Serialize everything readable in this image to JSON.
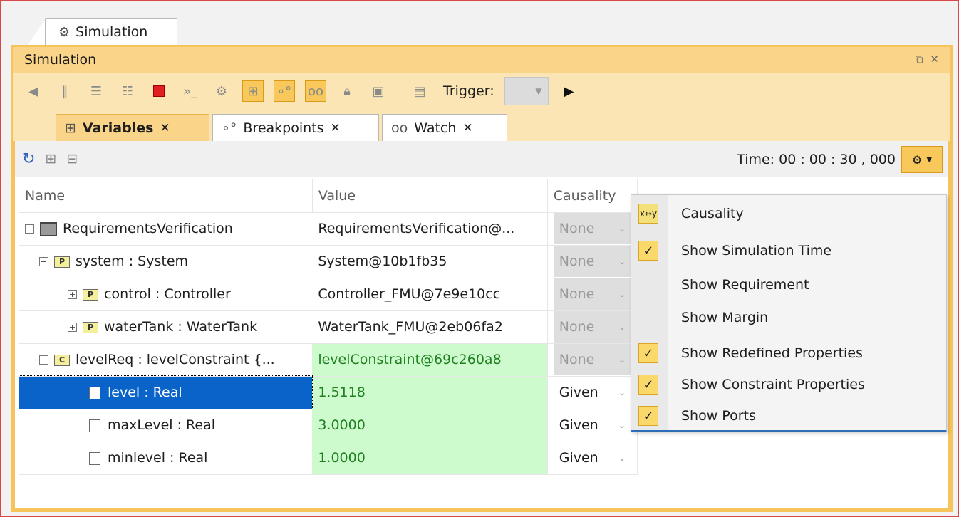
{
  "window": {
    "tab_label": "Simulation"
  },
  "panel": {
    "title": "Simulation",
    "trigger_label": "Trigger:"
  },
  "subtabs": [
    {
      "label": "Variables",
      "active": true
    },
    {
      "label": "Breakpoints",
      "active": false
    },
    {
      "label": "Watch",
      "active": false
    }
  ],
  "content": {
    "time_label": "Time: 00 : 00 : 30 , 000"
  },
  "table": {
    "headers": [
      "Name",
      "Value",
      "Causality"
    ],
    "rows": [
      {
        "name": "RequirementsVerification",
        "value": "RequirementsVerification@...",
        "causality": "None"
      },
      {
        "name": "system : System",
        "value": "System@10b1fb35",
        "causality": "None"
      },
      {
        "name": "control : Controller",
        "value": "Controller_FMU@7e9e10cc",
        "causality": "None"
      },
      {
        "name": "waterTank : WaterTank",
        "value": "WaterTank_FMU@2eb06fa2",
        "causality": "None"
      },
      {
        "name": "levelReq : levelConstraint {...",
        "value": "levelConstraint@69c260a8",
        "causality": "None"
      },
      {
        "name": "level : Real",
        "value": "1.5118",
        "causality": "Given"
      },
      {
        "name": "maxLevel : Real",
        "value": "3.0000",
        "causality": "Given"
      },
      {
        "name": "minlevel : Real",
        "value": "1.0000",
        "causality": "Given"
      }
    ]
  },
  "menu": {
    "items": [
      {
        "label": "Causality",
        "checked": false
      },
      {
        "label": "Show Simulation Time",
        "checked": true
      },
      {
        "label": "Show Requirement",
        "checked": false
      },
      {
        "label": "Show Margin",
        "checked": false
      },
      {
        "label": "Show Redefined Properties",
        "checked": true
      },
      {
        "label": "Show Constraint Properties",
        "checked": true
      },
      {
        "label": "Show Ports",
        "checked": true
      }
    ]
  },
  "colors": {
    "panel_border": "#f7c35b",
    "selected_row": "#0a63c8",
    "value_green_bg": "#cdfbcd",
    "value_green_text": "#208020"
  }
}
